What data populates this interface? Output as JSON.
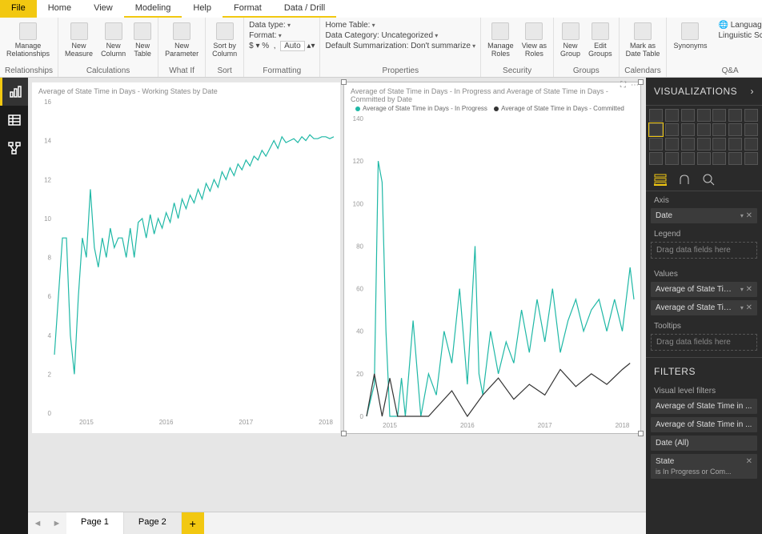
{
  "tabs": {
    "file": "File",
    "home": "Home",
    "view": "View",
    "modeling": "Modeling",
    "help": "Help",
    "format": "Format",
    "datadrill": "Data / Drill"
  },
  "ribbon": {
    "relationships": {
      "manage": "Manage\nRelationships",
      "group": "Relationships"
    },
    "calculations": {
      "newMeasure": "New\nMeasure",
      "newColumn": "New\nColumn",
      "newTable": "New\nTable",
      "group": "Calculations"
    },
    "whatif": {
      "newParam": "New\nParameter",
      "group": "What If"
    },
    "sort": {
      "sortby": "Sort by\nColumn",
      "group": "Sort"
    },
    "formatting": {
      "datatype": "Data type:",
      "format": "Format:",
      "currency": "$",
      "percent": "%",
      "comma": ",",
      "auto": "Auto",
      "group": "Formatting"
    },
    "properties": {
      "homeTable": "Home Table:",
      "dataCategory": "Data Category: Uncategorized",
      "summarization": "Default Summarization: Don't summarize",
      "group": "Properties"
    },
    "security": {
      "manageRoles": "Manage\nRoles",
      "viewAs": "View as\nRoles",
      "group": "Security"
    },
    "groups": {
      "newGroup": "New\nGroup",
      "editGroups": "Edit\nGroups",
      "group": "Groups"
    },
    "calendars": {
      "mark": "Mark as\nDate Table",
      "group": "Calendars"
    },
    "qa": {
      "synonyms": "Synonyms",
      "language": "Language",
      "schema": "Linguistic Schema",
      "group": "Q&A"
    }
  },
  "pages": {
    "p1": "Page 1",
    "p2": "Page 2"
  },
  "rightpane": {
    "vizHeader": "VISUALIZATIONS",
    "axis": "Axis",
    "axisField": "Date",
    "legend": "Legend",
    "legendPlaceholder": "Drag data fields here",
    "values": "Values",
    "value1": "Average of State Time in",
    "value2": "Average of State Time in",
    "tooltips": "Tooltips",
    "tooltipsPlaceholder": "Drag data fields here",
    "filtersHeader": "FILTERS",
    "visualFilters": "Visual level filters",
    "f1": "Average of State Time in ...",
    "f2": "Average of State Time in ...",
    "f3": "Date (All)",
    "f4": "State",
    "f4sub": "is In Progress or Com..."
  },
  "chart_data": [
    {
      "type": "line",
      "title": "Average of State Time in Days - Working States by Date",
      "xlabel": "",
      "ylabel": "",
      "xticks": [
        "2015",
        "2016",
        "2017",
        "2018"
      ],
      "yticks": [
        0,
        2,
        4,
        6,
        8,
        10,
        12,
        14,
        16
      ],
      "ylim": [
        0,
        16
      ],
      "series": [
        {
          "name": "Working States",
          "color": "#1fb8a6",
          "x": [
            2014.6,
            2014.7,
            2014.75,
            2014.8,
            2014.85,
            2014.9,
            2014.95,
            2015.0,
            2015.05,
            2015.1,
            2015.15,
            2015.2,
            2015.25,
            2015.3,
            2015.35,
            2015.4,
            2015.45,
            2015.5,
            2015.55,
            2015.6,
            2015.65,
            2015.7,
            2015.75,
            2015.8,
            2015.85,
            2015.9,
            2015.95,
            2016.0,
            2016.05,
            2016.1,
            2016.15,
            2016.2,
            2016.25,
            2016.3,
            2016.35,
            2016.4,
            2016.45,
            2016.5,
            2016.55,
            2016.6,
            2016.65,
            2016.7,
            2016.75,
            2016.8,
            2016.85,
            2016.9,
            2016.95,
            2017.0,
            2017.05,
            2017.1,
            2017.15,
            2017.2,
            2017.25,
            2017.3,
            2017.35,
            2017.4,
            2017.45,
            2017.5,
            2017.55,
            2017.6,
            2017.65,
            2017.7,
            2017.75,
            2017.8,
            2017.85,
            2017.9,
            2017.95,
            2018.0,
            2018.05,
            2018.1
          ],
          "y": [
            3,
            9,
            9,
            4,
            2,
            6,
            9,
            8,
            11.5,
            8.5,
            7.5,
            9,
            8,
            9.5,
            8.5,
            9,
            9,
            8,
            9.5,
            8,
            9.8,
            10,
            9,
            10.2,
            9.2,
            10,
            9.5,
            10.3,
            9.8,
            10.8,
            10,
            11,
            10.5,
            11.2,
            10.8,
            11.5,
            11,
            11.8,
            11.4,
            12,
            11.6,
            12.4,
            12,
            12.6,
            12.2,
            12.8,
            12.5,
            13,
            12.7,
            13.2,
            13,
            13.5,
            13.2,
            13.6,
            14,
            13.6,
            14.2,
            13.9,
            14,
            14.1,
            13.9,
            14.2,
            14,
            14.3,
            14.1,
            14.1,
            14.2,
            14.2,
            14.1,
            14.2
          ]
        }
      ]
    },
    {
      "type": "line",
      "title": "Average of State Time in Days - In Progress and Average of State Time in Days - Committed by Date",
      "legend": [
        "Average of State Time in Days - In Progress",
        "Average of State Time in Days - Committed"
      ],
      "legendColors": [
        "#1fb8a6",
        "#333"
      ],
      "xlabel": "",
      "ylabel": "",
      "xticks": [
        "2015",
        "2016",
        "2017",
        "2018"
      ],
      "yticks": [
        0,
        20,
        40,
        60,
        80,
        100,
        120,
        140
      ],
      "ylim": [
        0,
        140
      ],
      "series": [
        {
          "name": "In Progress",
          "color": "#1fb8a6",
          "x": [
            2014.7,
            2014.8,
            2014.85,
            2014.9,
            2014.95,
            2015.0,
            2015.05,
            2015.1,
            2015.15,
            2015.2,
            2015.3,
            2015.4,
            2015.5,
            2015.6,
            2015.7,
            2015.8,
            2015.9,
            2016.0,
            2016.1,
            2016.15,
            2016.2,
            2016.3,
            2016.4,
            2016.5,
            2016.6,
            2016.7,
            2016.8,
            2016.9,
            2017.0,
            2017.1,
            2017.2,
            2017.3,
            2017.4,
            2017.5,
            2017.6,
            2017.7,
            2017.8,
            2017.9,
            2018.0,
            2018.1,
            2018.15
          ],
          "y": [
            0,
            15,
            120,
            110,
            40,
            0,
            0,
            0,
            18,
            0,
            45,
            0,
            20,
            10,
            40,
            25,
            60,
            15,
            80,
            20,
            10,
            40,
            20,
            35,
            25,
            50,
            30,
            55,
            35,
            60,
            30,
            45,
            55,
            40,
            50,
            55,
            40,
            55,
            40,
            70,
            55
          ]
        },
        {
          "name": "Committed",
          "color": "#333",
          "x": [
            2014.7,
            2014.8,
            2014.9,
            2015.0,
            2015.1,
            2015.5,
            2015.8,
            2016.0,
            2016.2,
            2016.4,
            2016.6,
            2016.8,
            2017.0,
            2017.2,
            2017.4,
            2017.6,
            2017.8,
            2018.0,
            2018.1
          ],
          "y": [
            0,
            20,
            0,
            18,
            0,
            0,
            12,
            0,
            10,
            18,
            8,
            15,
            10,
            22,
            14,
            20,
            15,
            22,
            25
          ]
        }
      ]
    }
  ]
}
